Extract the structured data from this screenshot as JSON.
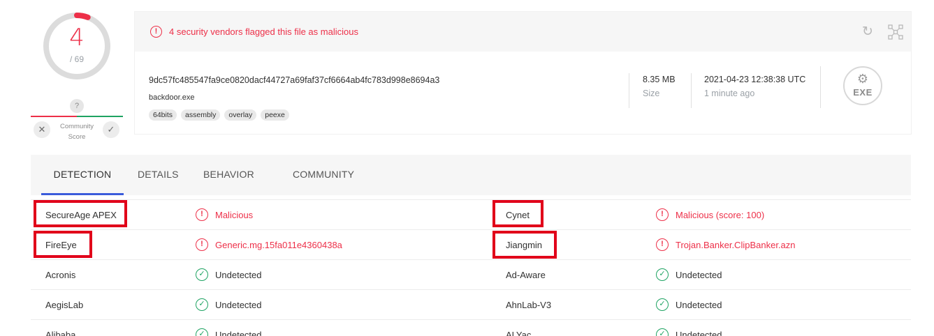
{
  "score": {
    "detections": "4",
    "total": "/ 69",
    "question": "?",
    "community_label": "Community Score",
    "vote_down_icon": "close-icon",
    "vote_up_icon": "check-icon",
    "malicious_fraction": 0.058
  },
  "summary": {
    "alert_text": "4 security vendors flagged this file as malicious",
    "hash": "9dc57fc485547fa9ce0820dacf44727a69faf37cf6664ab4fc783d998e8694a3",
    "filename": "backdoor.exe",
    "tags": [
      "64bits",
      "assembly",
      "overlay",
      "peexe"
    ],
    "size_value": "8.35 MB",
    "size_label": "Size",
    "date_value": "2021-04-23 12:38:38 UTC",
    "date_label": "1 minute ago",
    "file_type": "EXE"
  },
  "tabs": {
    "detection": "DETECTION",
    "details": "DETAILS",
    "behavior": "BEHAVIOR",
    "community": "COMMUNITY"
  },
  "detections": [
    {
      "vendor_a": "SecureAge APEX",
      "result_a": "Malicious",
      "status_a": "malicious",
      "vendor_b": "Cynet",
      "result_b": "Malicious (score: 100)",
      "status_b": "malicious"
    },
    {
      "vendor_a": "FireEye",
      "result_a": "Generic.mg.15fa011e4360438a",
      "status_a": "malicious",
      "vendor_b": "Jiangmin",
      "result_b": "Trojan.Banker.ClipBanker.azn",
      "status_b": "malicious"
    },
    {
      "vendor_a": "Acronis",
      "result_a": "Undetected",
      "status_a": "undetected",
      "vendor_b": "Ad-Aware",
      "result_b": "Undetected",
      "status_b": "undetected"
    },
    {
      "vendor_a": "AegisLab",
      "result_a": "Undetected",
      "status_a": "undetected",
      "vendor_b": "AhnLab-V3",
      "result_b": "Undetected",
      "status_b": "undetected"
    },
    {
      "vendor_a": "Alibaba",
      "result_a": "Undetected",
      "status_a": "undetected",
      "vendor_b": "ALYac",
      "result_b": "Undetected",
      "status_b": "undetected"
    }
  ],
  "colors": {
    "malicious": "#ed2f48",
    "clean": "#1ea362",
    "highlight": "#e1001a",
    "tab_active": "#3b5bdb"
  }
}
